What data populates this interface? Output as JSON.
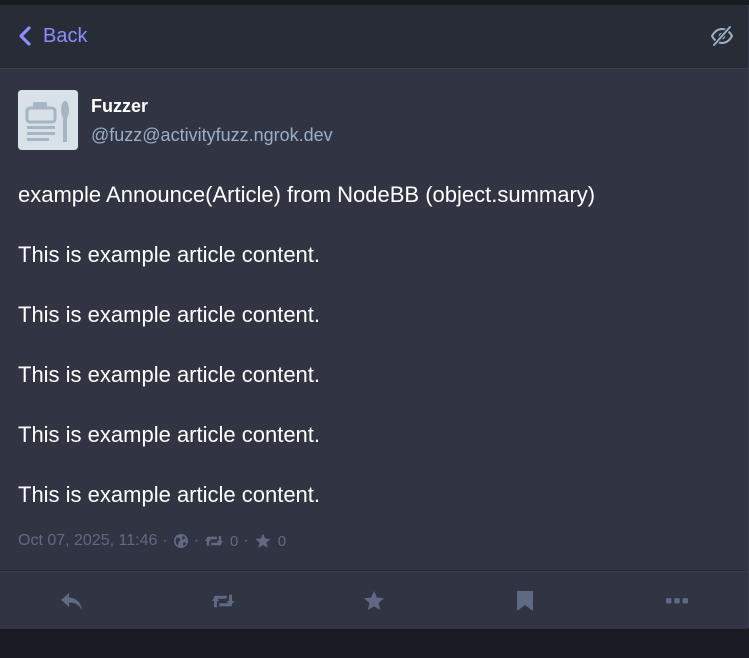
{
  "header": {
    "back_label": "Back",
    "back_icon": "chevron-left-icon",
    "hide_icon": "eye-slash-icon"
  },
  "status": {
    "author": {
      "display_name": "Fuzzer",
      "handle": "@fuzz@activityfuzz.ngrok.dev",
      "avatar_icon": "default-avatar-icon"
    },
    "content": [
      "example Announce(Article) from NodeBB (object.summary)",
      "This is example article content.",
      "This is example article content.",
      "This is example article content.",
      "This is example article content.",
      "This is example article content."
    ],
    "meta": {
      "timestamp": "Oct 07, 2025, 11:46",
      "separator": "·",
      "visibility_icon": "globe-icon",
      "boosts_count": "0",
      "favourites_count": "0"
    }
  },
  "actions": [
    {
      "name": "reply-button",
      "icon": "reply-icon"
    },
    {
      "name": "boost-button",
      "icon": "retweet-icon"
    },
    {
      "name": "favourite-button",
      "icon": "star-icon"
    },
    {
      "name": "bookmark-button",
      "icon": "bookmark-icon"
    },
    {
      "name": "more-button",
      "icon": "ellipsis-icon"
    }
  ],
  "colors": {
    "accent": "#8c8dff",
    "background": "#191b22",
    "panel": "#282c37",
    "status_background": "#313543",
    "text": "#ffffff",
    "secondary_text": "#9baec8",
    "muted_text": "#606984",
    "action_icon": "#606984"
  }
}
